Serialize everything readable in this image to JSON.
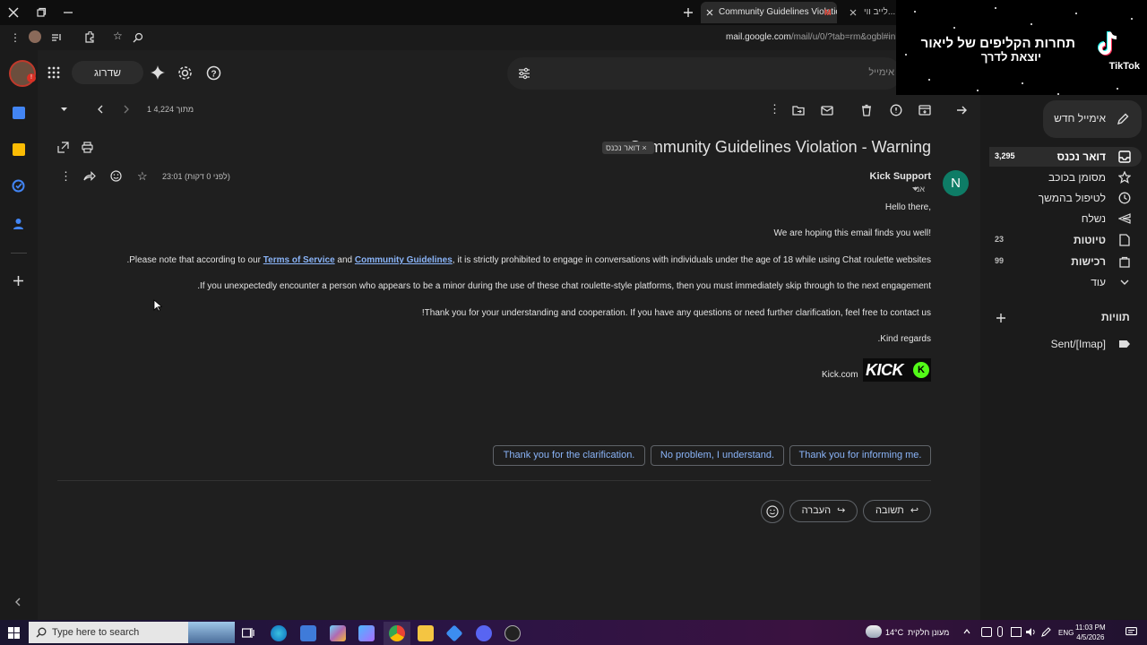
{
  "browser": {
    "active_tab_title": "Community Guidelines Violatio",
    "inactive_tab_title": "לייב ווי...",
    "url_domain": "mail.google.com",
    "url_path": "/mail/u/0/?tab=rm&ogbl#inb"
  },
  "overlay": {
    "line1": "תחרות הקליפים של ליאור",
    "line2": "יוצאת לדרך",
    "brand": "TikTok"
  },
  "gmail": {
    "upgrade_label": "שדרוג",
    "search_placeholder": "אימייל",
    "compose_label": "אימייל חדש",
    "pager": "1 מתוך 4,224",
    "nav": [
      {
        "label": "דואר נכנס",
        "count": "3,295",
        "icon": "inbox-icon"
      },
      {
        "label": "מסומן בכוכב",
        "count": "",
        "icon": "star-icon"
      },
      {
        "label": "לטיפול בהמשך",
        "count": "",
        "icon": "clock-icon"
      },
      {
        "label": "נשלח",
        "count": "",
        "icon": "send-icon"
      },
      {
        "label": "טיוטות",
        "count": "23",
        "icon": "draft-icon"
      },
      {
        "label": "רכישות",
        "count": "99",
        "icon": "purchases-icon"
      },
      {
        "label": "עוד",
        "count": "",
        "icon": "chevron-down-icon"
      }
    ],
    "labels_header": "תוויות",
    "labels": [
      {
        "label": "Sent/[Imap]",
        "icon": "label-icon"
      }
    ]
  },
  "email": {
    "subject": "Community Guidelines Violation - Warning",
    "label_chip": "דואר נכנס",
    "sender_initial": "N",
    "sender": "Kick Support",
    "to": "אני",
    "time": "23:01 (לפני 0 דקות)",
    "greeting": "Hello there,",
    "line1": "We are hoping this email finds you well!",
    "line2_pre": ".Please note that according to our ",
    "link1": "Terms of Service",
    "line2_mid": " and ",
    "link2": "Community Guidelines",
    "line2_post": ", it is strictly prohibited to engage in conversations with individuals under the age of 18 while using Chat roulette websites",
    "line3": ".If you unexpectedly encounter a person who appears to be a minor during the use of these chat roulette-style platforms, then you must immediately skip through to the next engagement",
    "line4": "!Thank you for your understanding and cooperation. If you have any questions or need further clarification, feel free to contact us",
    "closing": ".Kind regards",
    "logo_text": "KICK",
    "site": "Kick.com"
  },
  "smart_replies": [
    "Thank you for informing me.",
    "No problem, I understand.",
    "Thank you for the clarification."
  ],
  "actions": {
    "reply": "תשובה",
    "forward": "העברה"
  },
  "taskbar": {
    "search_placeholder": "Type here to search",
    "weather_temp": "14°C",
    "weather_desc": "מעונן חלקית",
    "language": "ENG",
    "time": "11:03 PM",
    "date": "4/5/2026"
  }
}
